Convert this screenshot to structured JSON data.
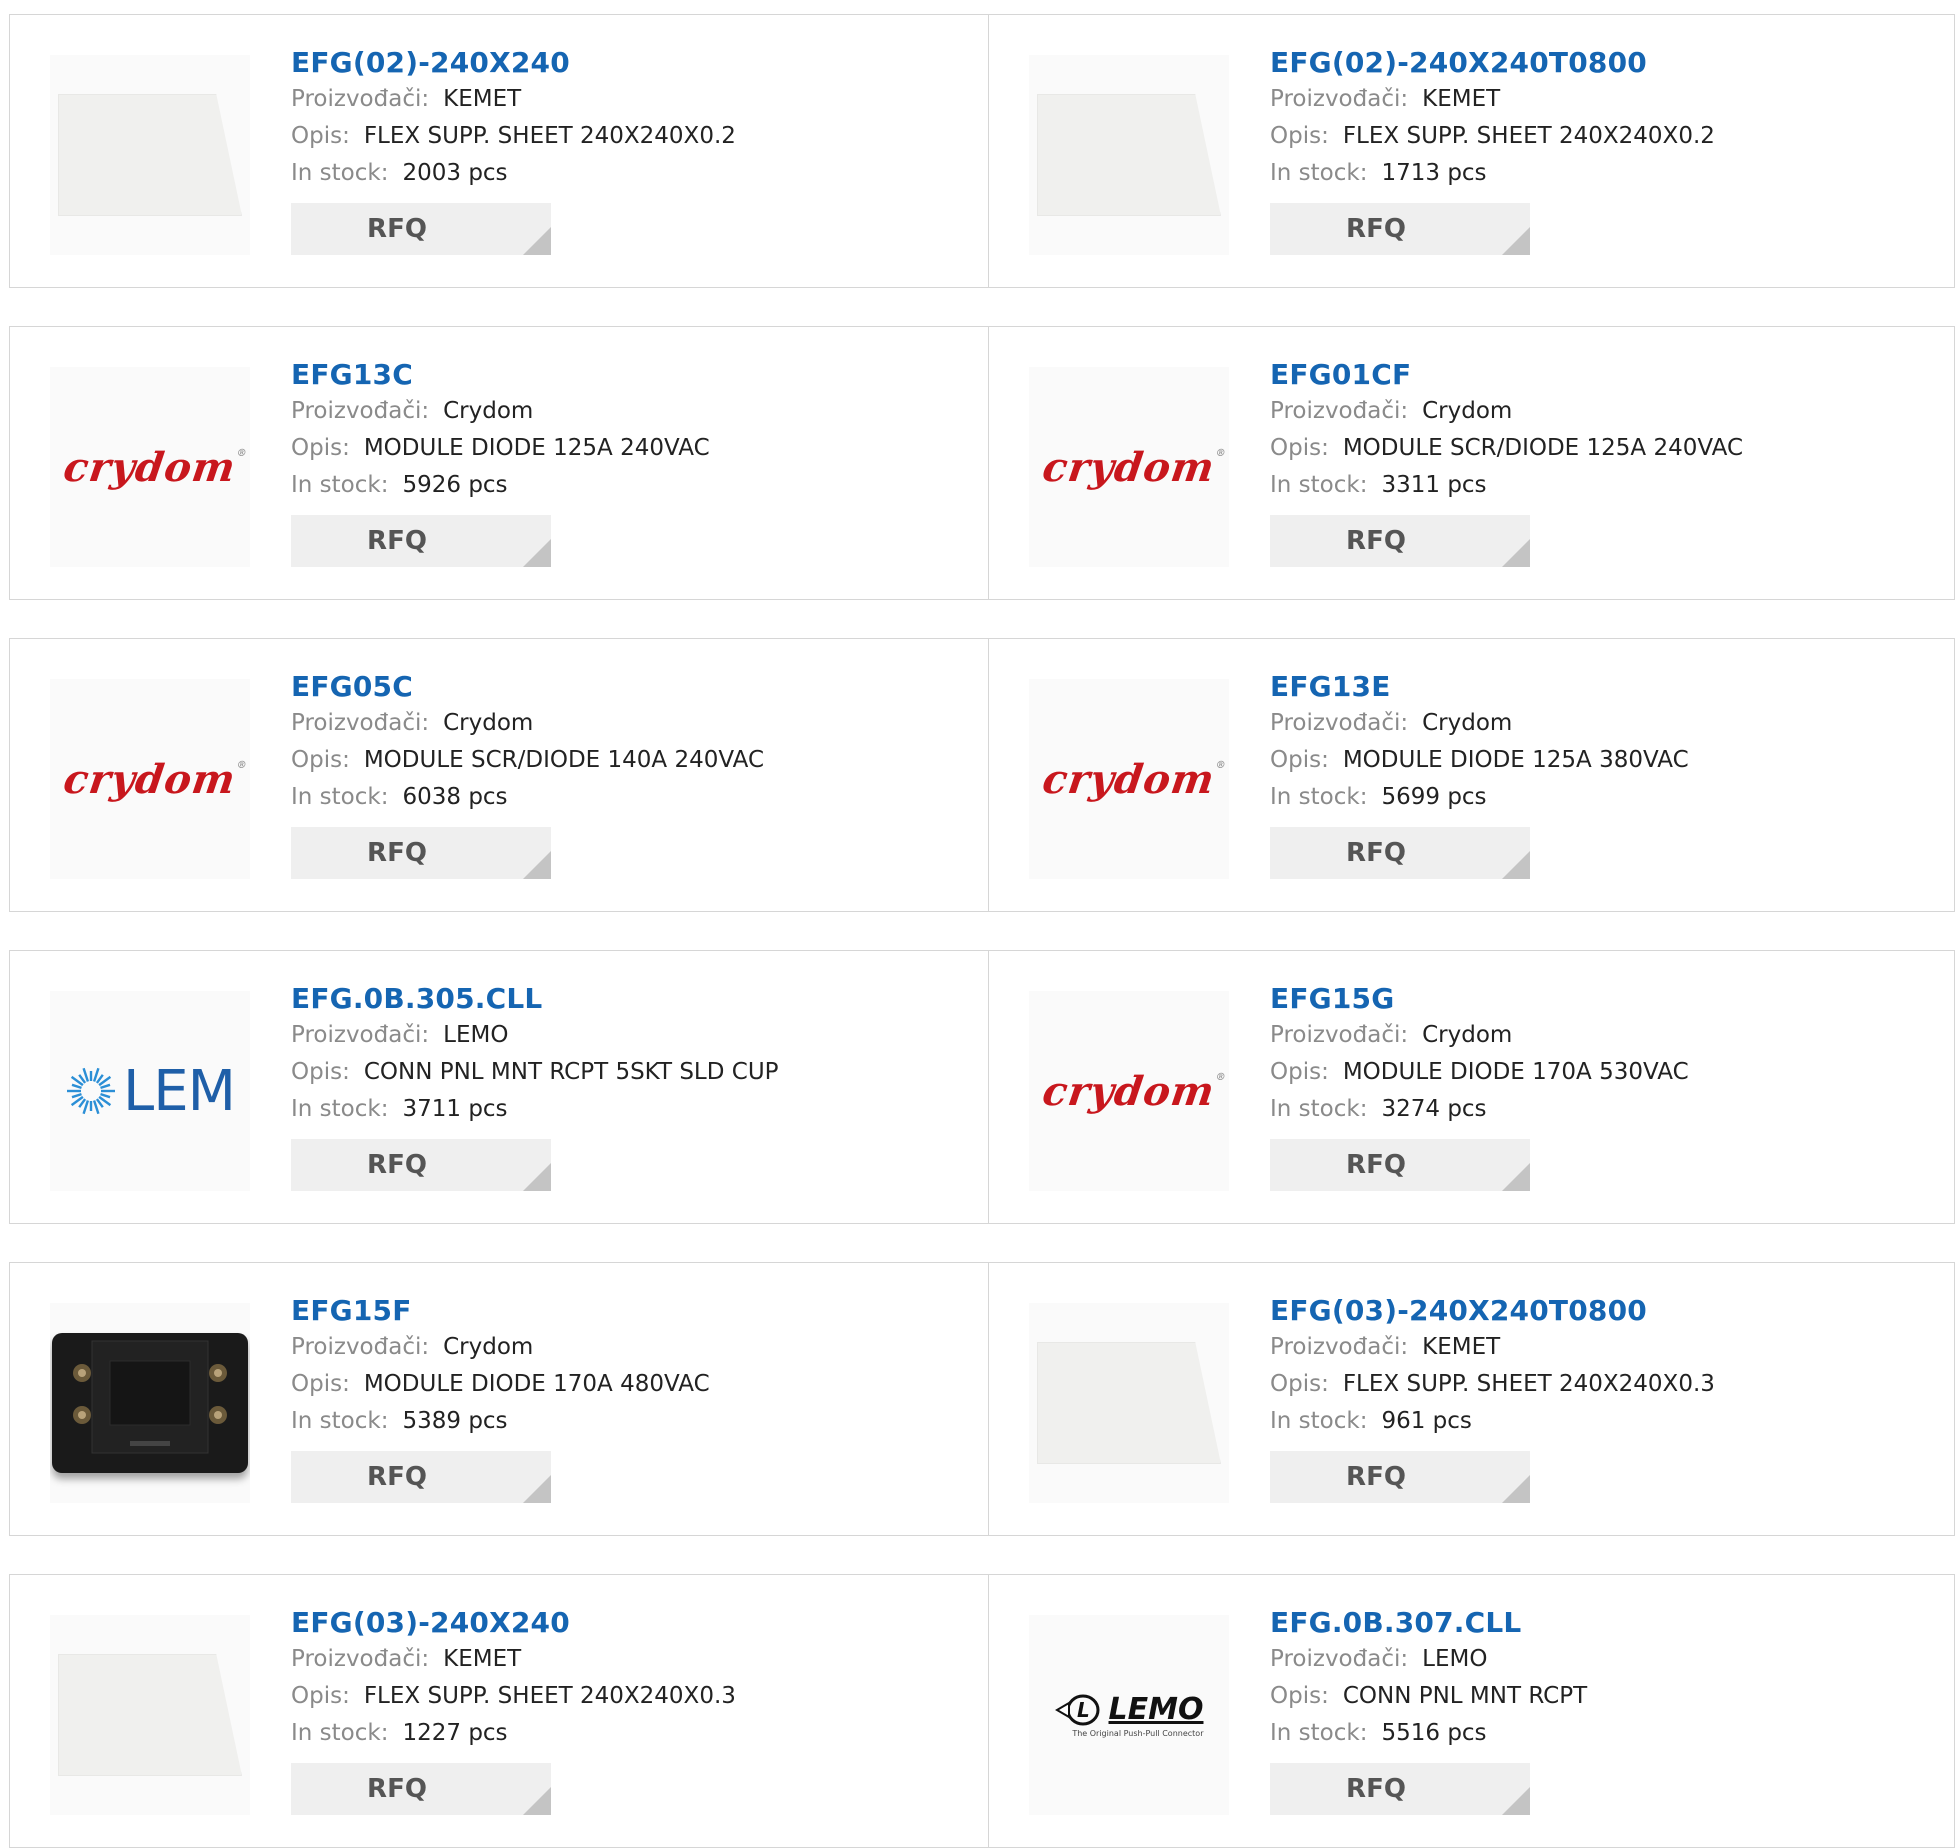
{
  "labels": {
    "manufacturer": "Proizvođači:",
    "description": "Opis:",
    "stock": "In stock:"
  },
  "products": [
    {
      "part": "EFG(02)-240X240",
      "manufacturer": "KEMET",
      "description": "FLEX SUPP. SHEET 240X240X0.2",
      "stock": "2003 pcs",
      "rfq": "RFQ",
      "image": "white-sheet"
    },
    {
      "part": "EFG(02)-240X240T0800",
      "manufacturer": "KEMET",
      "description": "FLEX SUPP. SHEET 240X240X0.2",
      "stock": "1713 pcs",
      "rfq": "RFQ",
      "image": "white-sheet"
    },
    {
      "part": "EFG13C",
      "manufacturer": "Crydom",
      "description": "MODULE DIODE 125A 240VAC",
      "stock": "5926 pcs",
      "rfq": "RFQ",
      "image": "crydom-logo"
    },
    {
      "part": "EFG01CF",
      "manufacturer": "Crydom",
      "description": "MODULE SCR/DIODE 125A 240VAC",
      "stock": "3311 pcs",
      "rfq": "RFQ",
      "image": "crydom-logo"
    },
    {
      "part": "EFG05C",
      "manufacturer": "Crydom",
      "description": "MODULE SCR/DIODE 140A 240VAC",
      "stock": "6038 pcs",
      "rfq": "RFQ",
      "image": "crydom-logo"
    },
    {
      "part": "EFG13E",
      "manufacturer": "Crydom",
      "description": "MODULE DIODE 125A 380VAC",
      "stock": "5699 pcs",
      "rfq": "RFQ",
      "image": "crydom-logo"
    },
    {
      "part": "EFG.0B.305.CLL",
      "manufacturer": "LEMO",
      "description": "CONN PNL MNT RCPT 5SKT SLD CUP",
      "stock": "3711 pcs",
      "rfq": "RFQ",
      "image": "lem-logo"
    },
    {
      "part": "EFG15G",
      "manufacturer": "Crydom",
      "description": "MODULE DIODE 170A 530VAC",
      "stock": "3274 pcs",
      "rfq": "RFQ",
      "image": "crydom-logo"
    },
    {
      "part": "EFG15F",
      "manufacturer": "Crydom",
      "description": "MODULE DIODE 170A 480VAC",
      "stock": "5389 pcs",
      "rfq": "RFQ",
      "image": "diode-module"
    },
    {
      "part": "EFG(03)-240X240T0800",
      "manufacturer": "KEMET",
      "description": "FLEX SUPP. SHEET 240X240X0.3",
      "stock": "961 pcs",
      "rfq": "RFQ",
      "image": "white-sheet"
    },
    {
      "part": "EFG(03)-240X240",
      "manufacturer": "KEMET",
      "description": "FLEX SUPP. SHEET 240X240X0.3",
      "stock": "1227 pcs",
      "rfq": "RFQ",
      "image": "white-sheet"
    },
    {
      "part": "EFG.0B.307.CLL",
      "manufacturer": "LEMO",
      "description": "CONN PNL MNT RCPT",
      "stock": "5516 pcs",
      "rfq": "RFQ",
      "image": "lemo-logo"
    }
  ],
  "logos": {
    "crydom": "crydom",
    "lem": "LEM",
    "lemo": "LEMO",
    "lemo_tagline": "The Original Push-Pull Connector"
  },
  "colors": {
    "part_link": "#1565b2",
    "crydom_red": "#c8171d",
    "lem_blue": "#1f5fa8",
    "rfq_bg": "#efefef",
    "border": "#d6d6d6"
  }
}
